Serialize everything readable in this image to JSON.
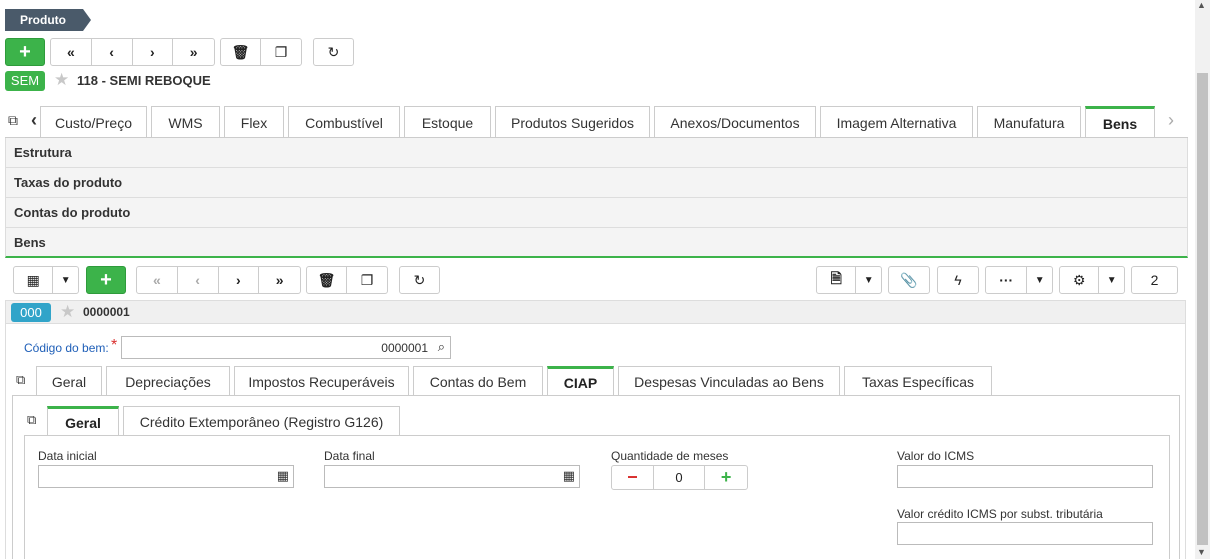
{
  "breadcrumb": "Produto",
  "top_badge": "SEM",
  "record_title": "118 - SEMI REBOQUE",
  "main_tabs": [
    "Custo/Preço",
    "WMS",
    "Flex",
    "Combustível",
    "Estoque",
    "Produtos Sugeridos",
    "Anexos/Documentos",
    "Imagem Alternativa",
    "Manufatura",
    "Bens"
  ],
  "sections": [
    "Estrutura",
    "Taxas do produto",
    "Contas do produto",
    "Bens"
  ],
  "sub_badge": "000",
  "sub_record": "0000001",
  "page_count": "2",
  "codigo_label": "Código do bem:",
  "codigo_required": "*",
  "codigo_value": "0000001",
  "inner_tabs": [
    "Geral",
    "Depreciações",
    "Impostos Recuperáveis",
    "Contas do Bem",
    "CIAP",
    "Despesas Vinculadas ao Bens",
    "Taxas Específicas"
  ],
  "ciap_tabs": [
    "Geral",
    "Crédito Extemporâneo (Registro G126)"
  ],
  "fields": {
    "data_inicial": "Data inicial",
    "data_final": "Data final",
    "quantidade_meses": "Quantidade de meses",
    "quantidade_value": "0",
    "valor_icms": "Valor do ICMS",
    "valor_credito": "Valor crédito ICMS por subst. tributária"
  },
  "colors": {
    "green": "#3cb34a",
    "badge_blue": "#31a4c9",
    "breadcrumb": "#4a5a6a",
    "required": "#d9302f",
    "link_blue": "#1f5fb8"
  }
}
